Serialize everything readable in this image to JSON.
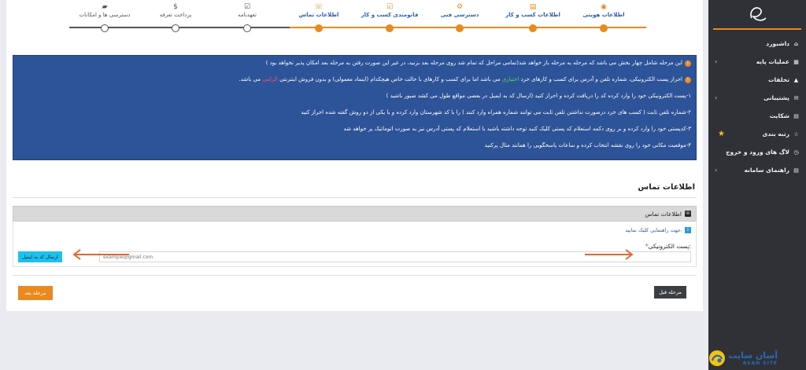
{
  "sidebar": {
    "items": [
      {
        "label": "داشبورد",
        "icon": "home-icon",
        "glyph": "⌂",
        "chevron": false
      },
      {
        "label": "عملیات پایه",
        "icon": "grid-icon",
        "glyph": "▦",
        "chevron": true
      },
      {
        "label": "تخلفات",
        "icon": "warning-icon",
        "glyph": "▲",
        "chevron": false
      },
      {
        "label": "پشتیبانی",
        "icon": "chat-icon",
        "glyph": "✉",
        "chevron": true
      },
      {
        "label": "شکایت",
        "icon": "document-icon",
        "glyph": "▤",
        "chevron": false
      },
      {
        "label": "رتبه بندی",
        "icon": "star-outline-icon",
        "glyph": "☆",
        "chevron": false,
        "star": true
      },
      {
        "label": "لاگ های ورود و خروج",
        "icon": "clock-icon",
        "glyph": "◷",
        "chevron": false
      },
      {
        "label": "راهنمای سامانه",
        "icon": "file-icon",
        "glyph": "▤",
        "chevron": true
      }
    ],
    "brand_fa": "آسان سایت",
    "brand_en": "ASAN SITE"
  },
  "stepper": {
    "steps": [
      {
        "label": "اطلاعات هویتی",
        "glyph": "◉",
        "icon": "user-icon",
        "state": "done"
      },
      {
        "label": "اطلاعات کسب و کار",
        "glyph": "▤",
        "icon": "document-icon",
        "state": "done"
      },
      {
        "label": "دسترسی فنی",
        "glyph": "⚙",
        "icon": "gears-icon",
        "state": "done"
      },
      {
        "label": "قانومندی کسب و کار",
        "glyph": "☑",
        "icon": "checkbox-icon",
        "state": "done"
      },
      {
        "label": "اطلاعات تماس",
        "glyph": "☏",
        "icon": "phone-icon",
        "state": "done"
      },
      {
        "label": "تعهدنامه",
        "glyph": "☑",
        "icon": "pledge-icon",
        "state": "todo"
      },
      {
        "label": "پرداخت تعرفه",
        "glyph": "$",
        "icon": "dollar-icon",
        "state": "todo"
      },
      {
        "label": "دسترسی ها و امکانات",
        "glyph": "▰",
        "icon": "folder-icon",
        "state": "todo"
      }
    ]
  },
  "info": {
    "line1": "این مرحله شامل چهار بخش می باشد که مرحله به مرحله باز خواهد شد(تمامی مراحل که تمام شد روی مرحله بعد بزنید، در غیر این صورت رفتن به مرحله بعد امکان پذیر نخواهد بود )",
    "line2_a": "احراز پست الکترونیکی، شماره تلفن و آدرس برای کسب و کارهای خرد",
    "line2_green": "اختیاری",
    "line2_b": "می باشد اما برای کسب و کارهای با حالت خاص هیچکدام (اینماد معمولی) و بدون فروش اینترنتی",
    "line2_red": "الزامی",
    "line2_c": "می باشد.",
    "line3": "۱-پست الکترونیکی خود را وارد کرده کد را دریافت کرده و احراز کنید (ارسال کد به ایمیل در بعضی مواقع طول می کشد صبور باشید )",
    "line4": "۲-شماره تلفن ثابت ( کسب های خرد درصورت نداشتن تلفن ثابت می توانند شماره همراه وارد کنند ) را با کد شهرستان وارد کرده و با یکی از دو روش گفته شده احراز کنید",
    "line5": "۳-کدپستی خود را وارد کرده و بر روی دکمه استعلام کد پستی کلیک کنید توجه داشته باشید با استعلام کد پستی آدرس نیز به صورت اتوماتیک پر خواهد شد",
    "line6": "۴-موقعیت مکانی خود را روی نقشه انتخاب کرده و ساعات پاسخگویی را همانند مثال پرکنید"
  },
  "contact": {
    "section_title": "اطلاعات تماس",
    "panel_title": "اطلاعات تماس",
    "guide_text": "جهت راهنمایی کلیک نمایید.",
    "email_label": "پست الکترونیکی:",
    "email_required": "*",
    "email_placeholder": "example@gmail.com",
    "send_code_label": "ارسال کد به ایمیل"
  },
  "footer": {
    "next_label": "مرحله بعد",
    "prev_label": "مرحله قبل"
  },
  "colors": {
    "accent": "#e9891e",
    "info_bg": "#2d5398",
    "sidebar_bg": "#2f3136",
    "send_btn": "#1ec0ec"
  }
}
